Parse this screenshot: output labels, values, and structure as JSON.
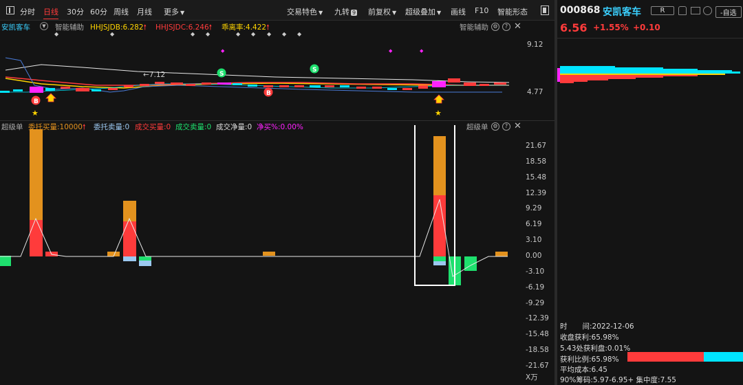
{
  "toolbar": {
    "items": [
      "分时",
      "日线",
      "30分",
      "60分",
      "周线",
      "月线",
      "更多"
    ],
    "right_items": [
      "交易特色",
      "九转",
      "前复权",
      "超级叠加",
      "画线",
      "F10",
      "智能形态"
    ],
    "nine_badge": "9"
  },
  "stock": {
    "code": "000868",
    "name": "安凯客车",
    "r_label": "R",
    "watch_label": "-自选",
    "price": "6.56",
    "change_pct": "+1.55%",
    "change": "+0.10"
  },
  "kpanel": {
    "name": "安凯客车",
    "assist": "智能辅助",
    "ind1": "HHJSJDB:6.282",
    "ind2": "HHJSJDC:6.246",
    "ind3": "乖离率:4.422",
    "title_right": "智能辅助",
    "y_high": "9.12",
    "y_low": "4.77",
    "high_label": "←7.12",
    "signal_b": "B",
    "signal_s": "S"
  },
  "vpanel": {
    "title": "超级单",
    "ind1": "委托买量:10000",
    "ind2": "委托卖量:0",
    "ind3": "成交买量:0",
    "ind4": "成交卖量:0",
    "ind5": "成交净量:0",
    "ind6": "净买%:0.00%",
    "title_right": "超级单",
    "ticks": [
      "21.67",
      "18.58",
      "15.48",
      "12.39",
      "9.29",
      "6.19",
      "3.10",
      "0.00",
      "-3.10",
      "-6.19",
      "-9.29",
      "-12.39",
      "-15.48",
      "-18.58",
      "-21.67"
    ],
    "unit": "X万"
  },
  "chips": {
    "time_label": "时",
    "time_value": "间:2022-12-06",
    "profit": "收盘获利:65.98%",
    "profit_at": "5.43处获利盘:0.01%",
    "profit_ratio": "获利比例:65.98%",
    "avg_cost": "平均成本:6.45",
    "range90": "90%筹码:5.97-6.95+ 集中度:7.55",
    "profit_fraction": 0.66
  },
  "colors": {
    "up": "#ff3b3b",
    "down": "#1ee06e",
    "orange": "#e3921e",
    "cyan": "#00e5ff",
    "magenta": "#ff22ff",
    "yellow": "#ffd400",
    "lightblue": "#9cc8f0"
  },
  "chart_data": {
    "type": "bar",
    "title": "超级单",
    "ylim": [
      -21.67,
      21.67
    ],
    "series": [
      {
        "name": "委托买量",
        "values": [
          26.5,
          11.0,
          5.0,
          28.4
        ]
      },
      {
        "name": "成交买量",
        "values": [
          8.0,
          8.0,
          0,
          12.5
        ]
      }
    ]
  }
}
